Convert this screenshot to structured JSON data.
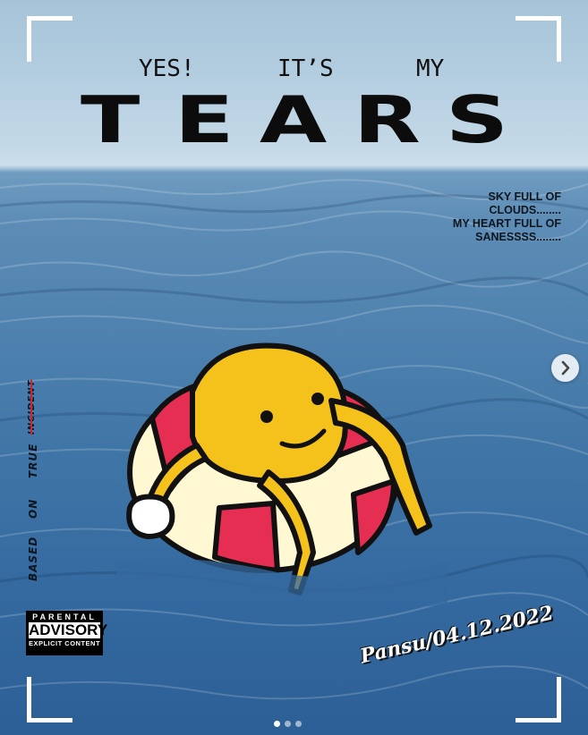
{
  "poster": {
    "subtitle": [
      "YES!",
      "IT’S",
      "MY"
    ],
    "title_letters": [
      "T",
      "E",
      "A",
      "R",
      "S"
    ],
    "sky_note": [
      "SKY FULL OF",
      "CLOUDS........",
      "MY HEART FULL OF",
      "SANESSSS........"
    ],
    "vertical_words": [
      "BASED",
      "ON",
      "TRUE",
      "INCIDENT"
    ],
    "struck_word": "INCIDENT",
    "advisory": {
      "line1": "PARENTAL",
      "line2": "ADVISORY",
      "line3": "EXPLICIT CONTENT"
    },
    "signature": "Pansu/04.12.2022"
  },
  "carousel": {
    "next_icon": "chevron-right-icon",
    "slides": 3,
    "active_slide": 1
  },
  "colors": {
    "sky": "#c4d9e7",
    "sea": "#3f75a6",
    "mascot_yellow": "#f5c21b",
    "float_red": "#e62e52",
    "float_cream": "#fff8d2",
    "strike_red": "#d0232d"
  }
}
